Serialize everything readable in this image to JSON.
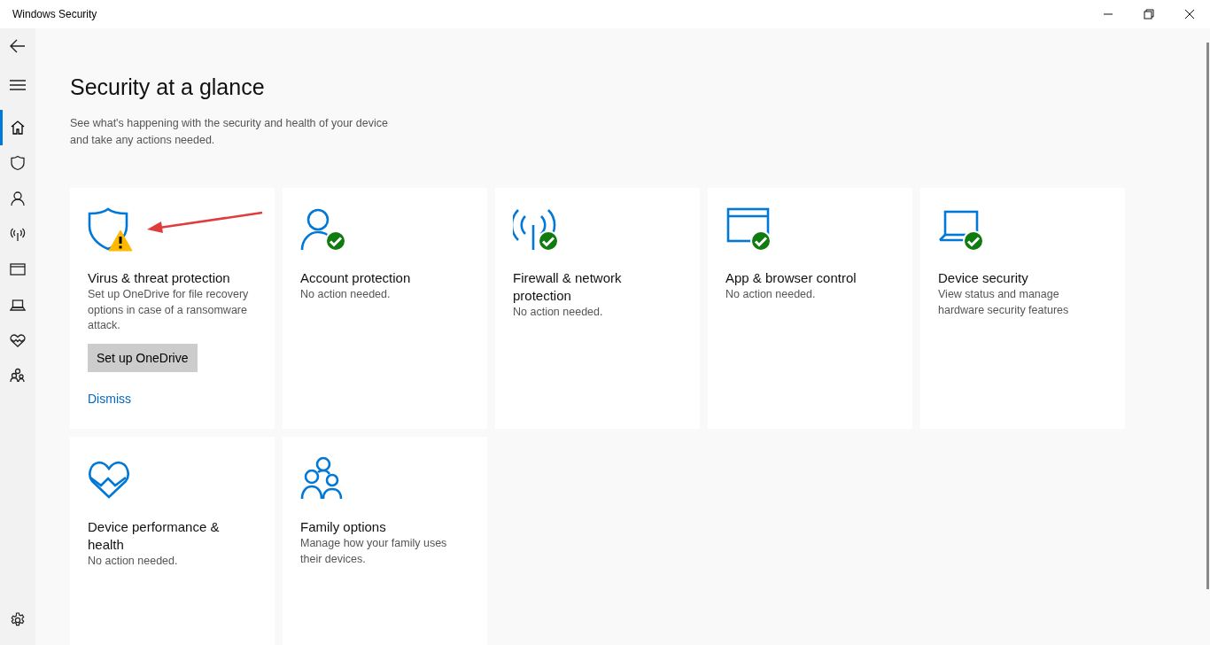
{
  "window": {
    "title": "Windows Security"
  },
  "sidebar": {
    "items": [
      {
        "kind": "home",
        "selected": true
      },
      {
        "kind": "shield",
        "selected": false
      },
      {
        "kind": "person",
        "selected": false
      },
      {
        "kind": "antenna",
        "selected": false
      },
      {
        "kind": "browser",
        "selected": false
      },
      {
        "kind": "laptop",
        "selected": false
      },
      {
        "kind": "heart",
        "selected": false
      },
      {
        "kind": "family",
        "selected": false
      }
    ]
  },
  "page": {
    "title": "Security at a glance",
    "subtitle": "See what's happening with the security and health of your device\nand take any actions needed."
  },
  "cards": [
    {
      "kind": "shield",
      "warning": true,
      "healthy": false,
      "title": "Virus & threat protection",
      "description": "Set up OneDrive for file recovery options in case of a ransomware attack.",
      "button": "Set up OneDrive",
      "link": "Dismiss"
    },
    {
      "kind": "person",
      "warning": false,
      "healthy": true,
      "title": "Account protection",
      "description": "No action needed."
    },
    {
      "kind": "antenna",
      "warning": false,
      "healthy": true,
      "title": "Firewall & network protection",
      "description": "No action needed."
    },
    {
      "kind": "browser",
      "warning": false,
      "healthy": true,
      "title": "App & browser control",
      "description": "No action needed."
    },
    {
      "kind": "laptop",
      "warning": false,
      "healthy": true,
      "title": "Device security",
      "description": "View status and manage hardware security features"
    },
    {
      "kind": "heart",
      "warning": false,
      "healthy": false,
      "title": "Device performance & health",
      "description": "No action needed."
    },
    {
      "kind": "family",
      "warning": false,
      "healthy": false,
      "title": "Family options",
      "description": "Manage how your family uses their devices."
    }
  ]
}
